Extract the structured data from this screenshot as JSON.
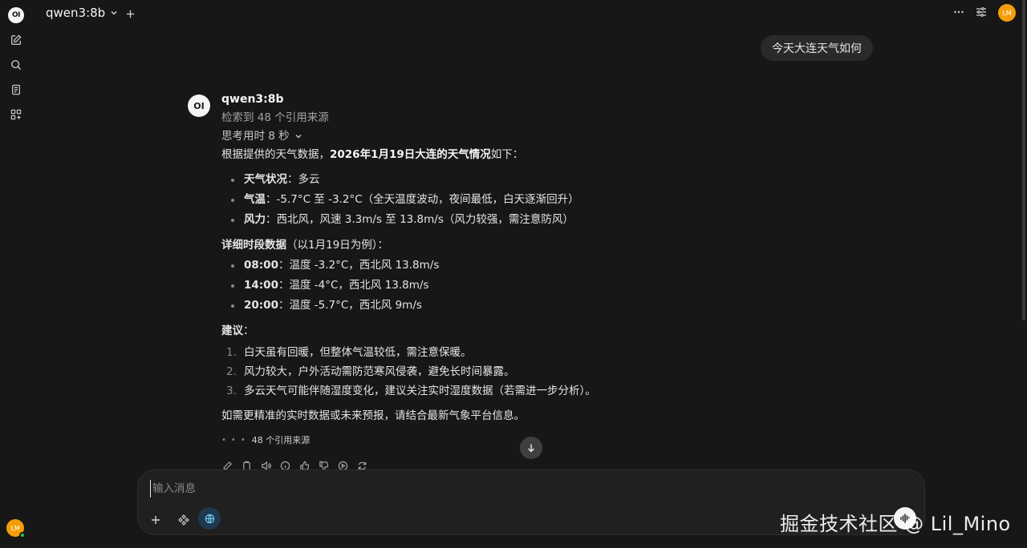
{
  "sidebar": {
    "logo": "OI",
    "avatar": "LM"
  },
  "header": {
    "model": "qwen3:8b",
    "avatar": "LM"
  },
  "user_message": "今天大连天气如何",
  "assistant": {
    "avatar": "OI",
    "name": "qwen3:8b",
    "search_status": "检索到 48 个引用来源",
    "thinking": "思考用时 8 秒",
    "intro_prefix": "根据提供的天气数据，",
    "intro_bold": "2026年1月19日大连的天气情况",
    "intro_suffix": "如下：",
    "summary": [
      {
        "label": "天气状况",
        "text": "：多云"
      },
      {
        "label": "气温",
        "text": "：-5.7°C 至 -3.2°C（全天温度波动，夜间最低，白天逐渐回升）"
      },
      {
        "label": "风力",
        "text": "：西北风，风速 3.3m/s 至 13.8m/s（风力较强，需注意防风）"
      }
    ],
    "detail_title": "详细时段数据",
    "detail_note": "（以1月19日为例）：",
    "details": [
      {
        "time": "08:00",
        "text": "：温度 -3.2°C，西北风 13.8m/s"
      },
      {
        "time": "14:00",
        "text": "：温度 -4°C，西北风 13.8m/s"
      },
      {
        "time": "20:00",
        "text": "：温度 -5.7°C，西北风 9m/s"
      }
    ],
    "advice_title": "建议",
    "advice_colon": "：",
    "advice": [
      {
        "n": "1.",
        "text": "白天虽有回暖，但整体气温较低，需注意保暖。"
      },
      {
        "n": "2.",
        "text": "风力较大，户外活动需防范寒风侵袭，避免长时间暴露。"
      },
      {
        "n": "3.",
        "text": "多云天气可能伴随湿度变化，建议关注实时湿度数据（若需进一步分析）。"
      }
    ],
    "closing": "如需更精准的实时数据或未来预报，请结合最新气象平台信息。",
    "sources_label": "48 个引用来源"
  },
  "composer": {
    "placeholder": "输入消息"
  },
  "watermark": "掘金技术社区 @ Lil_Mino"
}
